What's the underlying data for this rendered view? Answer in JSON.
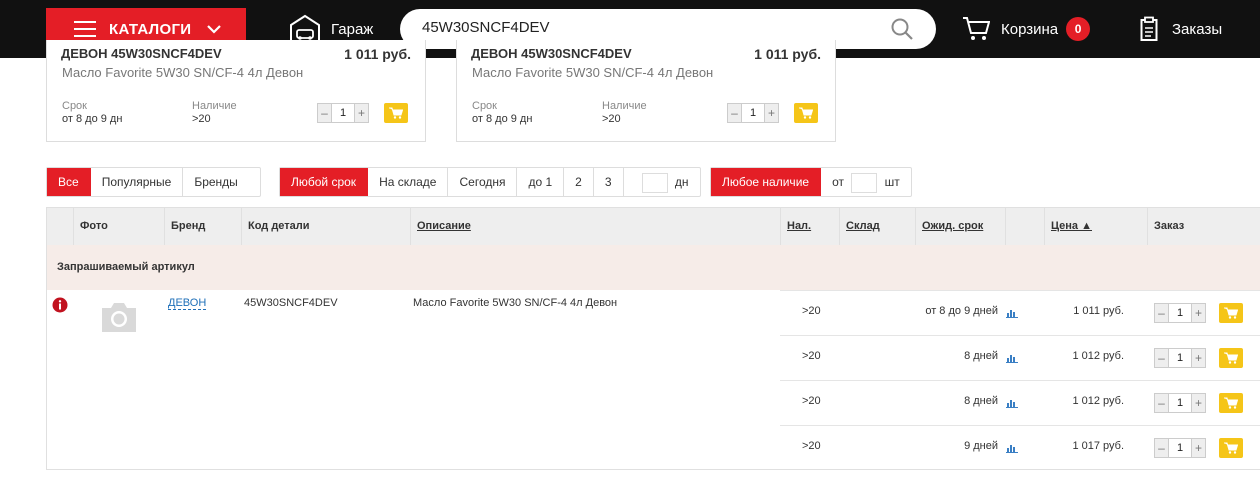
{
  "header": {
    "catalog_label": "КАТАЛОГИ",
    "garage_label": "Гараж",
    "search_value": "45W30SNCF4DEV",
    "cart_label": "Корзина",
    "cart_count": "0",
    "orders_label": "Заказы"
  },
  "cards": [
    {
      "title": "ДЕВОН 45W30SNCF4DEV",
      "price": "1 011 руб.",
      "description": "Масло Favorite 5W30 SN/CF-4 4л Девон",
      "term_label": "Срок",
      "term_value": "от 8 до 9 дн",
      "stock_label": "Наличие",
      "stock_value": ">20",
      "qty": "1"
    },
    {
      "title": "ДЕВОН 45W30SNCF4DEV",
      "price": "1 011 руб.",
      "description": "Масло Favorite 5W30 SN/CF-4 4л Девон",
      "term_label": "Срок",
      "term_value": "от 8 до 9 дн",
      "stock_label": "Наличие",
      "stock_value": ">20",
      "qty": "1"
    }
  ],
  "filters": {
    "scope": [
      "Все",
      "Популярные",
      "Бренды"
    ],
    "term": [
      "Любой срок",
      "На складе",
      "Сегодня",
      "до 1",
      "2",
      "3"
    ],
    "term_days_unit": "дн",
    "stock_any": "Любое наличие",
    "stock_from": "от",
    "stock_unit": "шт"
  },
  "table": {
    "headers": {
      "photo": "Фото",
      "brand": "Бренд",
      "code": "Код детали",
      "description": "Описание",
      "stock": "Нал.",
      "warehouse": "Склад",
      "term": "Ожид. срок",
      "price": "Цена ▲",
      "order": "Заказ"
    },
    "requested_label": "Запрашиваемый артикул",
    "item": {
      "brand": "ДЕВОН",
      "code": "45W30SNCF4DEV",
      "description": "Масло Favorite 5W30 SN/CF-4 4л Девон"
    },
    "offers": [
      {
        "qty": ">20",
        "term": "от 8 до 9 дней",
        "price": "1 011 руб.",
        "order_qty": "1"
      },
      {
        "qty": ">20",
        "term": "8 дней",
        "price": "1 012 руб.",
        "order_qty": "1"
      },
      {
        "qty": ">20",
        "term": "8 дней",
        "price": "1 012 руб.",
        "order_qty": "1"
      },
      {
        "qty": ">20",
        "term": "9 дней",
        "price": "1 017 руб.",
        "order_qty": "1"
      }
    ]
  },
  "colors": {
    "brand_red": "#e41e26",
    "cart_yellow": "#f5c518",
    "link_blue": "#1e6fb8",
    "topbar": "#111111"
  }
}
